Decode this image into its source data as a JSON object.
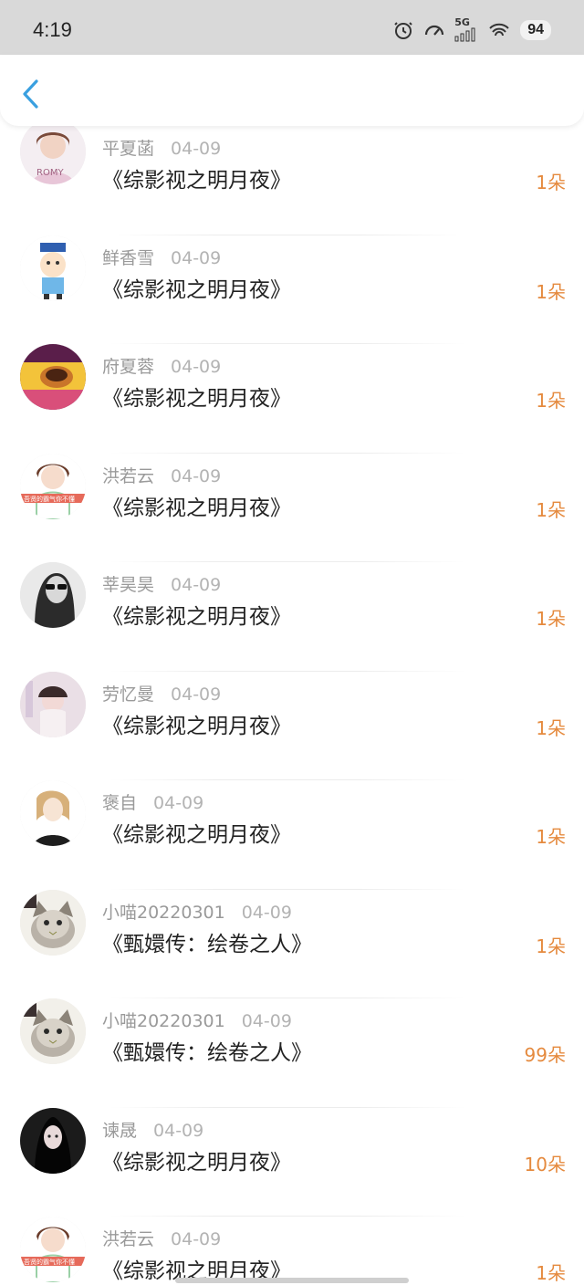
{
  "status": {
    "time": "4:19",
    "network": "5G",
    "battery": "94"
  },
  "colors": {
    "accent": "#3aa0e0",
    "count": "#e58a3e"
  },
  "list": [
    {
      "name": "平夏菡",
      "date": "04-09",
      "title": "《综影视之明月夜》",
      "count": "1朵",
      "avatar": "girl-photo-avatar"
    },
    {
      "name": "鲜香雪",
      "date": "04-09",
      "title": "《综影视之明月夜》",
      "count": "1朵",
      "avatar": "cartoon-boy-avatar"
    },
    {
      "name": "府夏蓉",
      "date": "04-09",
      "title": "《综影视之明月夜》",
      "count": "1朵",
      "avatar": "yellow-cup-avatar"
    },
    {
      "name": "洪若云",
      "date": "04-09",
      "title": "《综影视之明月夜》",
      "count": "1朵",
      "avatar": "girl-banner-avatar"
    },
    {
      "name": "莘昊昊",
      "date": "04-09",
      "title": "《综影视之明月夜》",
      "count": "1朵",
      "avatar": "bw-sunglasses-avatar"
    },
    {
      "name": "劳忆曼",
      "date": "04-09",
      "title": "《综影视之明月夜》",
      "count": "1朵",
      "avatar": "girl-hat-avatar"
    },
    {
      "name": "褒自",
      "date": "04-09",
      "title": "《综影视之明月夜》",
      "count": "1朵",
      "avatar": "anime-girl-avatar"
    },
    {
      "name": "小喵20220301",
      "date": "04-09",
      "title": "《甄嬛传：绘卷之人》",
      "count": "1朵",
      "avatar": "kitten-avatar"
    },
    {
      "name": "小喵20220301",
      "date": "04-09",
      "title": "《甄嬛传：绘卷之人》",
      "count": "99朵",
      "avatar": "kitten-avatar"
    },
    {
      "name": "谏晟",
      "date": "04-09",
      "title": "《综影视之明月夜》",
      "count": "10朵",
      "avatar": "dark-girl-avatar"
    },
    {
      "name": "洪若云",
      "date": "04-09",
      "title": "《综影视之明月夜》",
      "count": "1朵",
      "avatar": "girl-banner-avatar"
    }
  ]
}
